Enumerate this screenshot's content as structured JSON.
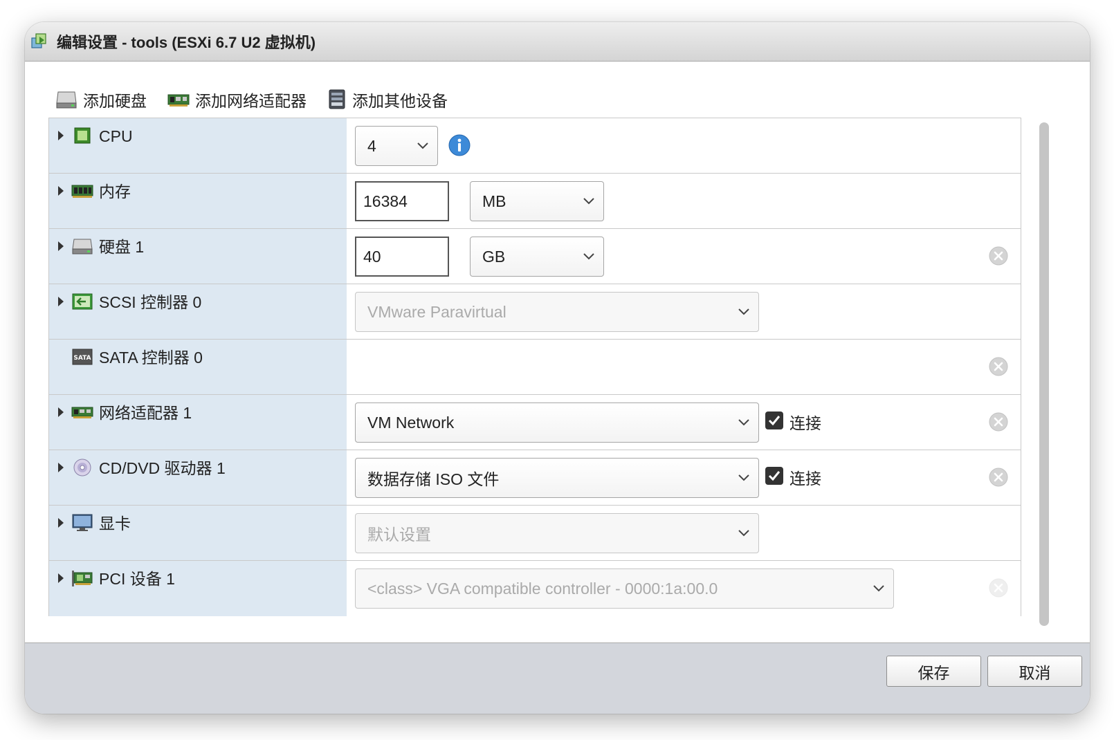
{
  "window": {
    "title": "编辑设置 - tools (ESXi 6.7 U2 虚拟机)"
  },
  "toolbar": {
    "add_disk": "添加硬盘",
    "add_network_adapter": "添加网络适配器",
    "add_other_device": "添加其他设备"
  },
  "devices": {
    "cpu": {
      "label": "CPU",
      "value": "4"
    },
    "memory": {
      "label": "内存",
      "value": "16384",
      "unit": "MB"
    },
    "disk": {
      "label": "硬盘 1",
      "value": "40",
      "unit": "GB"
    },
    "scsi": {
      "label": "SCSI 控制器 0",
      "value": "VMware Paravirtual"
    },
    "sata": {
      "label": "SATA 控制器 0",
      "icon_text": "SATA"
    },
    "network": {
      "label": "网络适配器 1",
      "value": "VM Network",
      "connect_label": "连接",
      "connected": true
    },
    "cdrom": {
      "label": "CD/DVD 驱动器 1",
      "value": "数据存储 ISO 文件",
      "connect_label": "连接",
      "connected": true
    },
    "video": {
      "label": "显卡",
      "value": "默认设置"
    },
    "pci": {
      "label": "PCI 设备 1",
      "value": "<class> VGA compatible controller - 0000:1a:00.0"
    }
  },
  "footer": {
    "save": "保存",
    "cancel": "取消"
  },
  "colors": {
    "label_column_bg": "#dde8f2",
    "footer_bg": "#d3d6dc",
    "info_icon": "#3d8ad8"
  }
}
